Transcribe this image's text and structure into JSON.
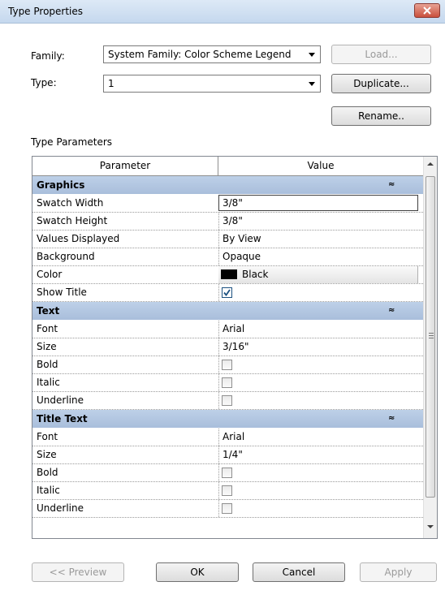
{
  "window": {
    "title": "Type Properties"
  },
  "family": {
    "label": "Family:",
    "value": "System Family: Color Scheme Legend"
  },
  "type": {
    "label": "Type:",
    "value": "1"
  },
  "buttons": {
    "load": "Load...",
    "duplicate": "Duplicate...",
    "rename": "Rename..",
    "preview": "<< Preview",
    "ok": "OK",
    "cancel": "Cancel",
    "apply": "Apply"
  },
  "section_label": "Type Parameters",
  "grid": {
    "col_parameter": "Parameter",
    "col_value": "Value",
    "groups": [
      {
        "name": "Graphics",
        "collapse_glyph": "≈",
        "rows": [
          {
            "name": "Swatch Width",
            "value": "3/8\""
          },
          {
            "name": "Swatch Height",
            "value": "3/8\""
          },
          {
            "name": "Values Displayed",
            "value": "By View"
          },
          {
            "name": "Background",
            "value": "Opaque"
          },
          {
            "name": "Color",
            "value": "Black"
          },
          {
            "name": "Show Title",
            "value": ""
          }
        ]
      },
      {
        "name": "Text",
        "collapse_glyph": "≈",
        "rows": [
          {
            "name": "Font",
            "value": "Arial"
          },
          {
            "name": "Size",
            "value": "3/16\""
          },
          {
            "name": "Bold",
            "value": ""
          },
          {
            "name": "Italic",
            "value": ""
          },
          {
            "name": "Underline",
            "value": ""
          }
        ]
      },
      {
        "name": "Title Text",
        "collapse_glyph": "≈",
        "rows": [
          {
            "name": "Font",
            "value": "Arial"
          },
          {
            "name": "Size",
            "value": "1/4\""
          },
          {
            "name": "Bold",
            "value": ""
          },
          {
            "name": "Italic",
            "value": ""
          },
          {
            "name": "Underline",
            "value": ""
          }
        ]
      }
    ]
  },
  "checkbox_states": {
    "show_title": true,
    "text_bold": false,
    "text_italic": false,
    "text_underline": false,
    "title_bold": false,
    "title_italic": false,
    "title_underline": false
  },
  "color_swatch": "#000000"
}
